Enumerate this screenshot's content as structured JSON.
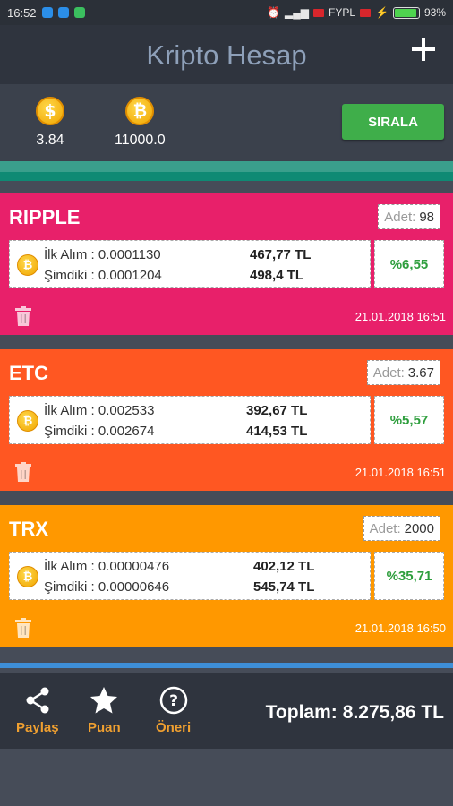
{
  "status_bar": {
    "time": "16:52",
    "carrier": "FYPL",
    "battery": "93%",
    "battery_level": 0.93
  },
  "header": {
    "title": "Kripto Hesap",
    "add_icon": "plus-icon"
  },
  "summary": {
    "stat1": {
      "icon": "dollar-coin-icon",
      "glyph": "$",
      "value": "3.84"
    },
    "stat2": {
      "icon": "bitcoin-coin-icon",
      "glyph": "₿",
      "value": "11000.0"
    },
    "sort_label": "SIRALA"
  },
  "colors": {
    "ripple": "#e8206a",
    "etc": "#ff5722",
    "trx": "#ff9800",
    "sort_button": "#3fae4a",
    "percent_text": "#2e9e3d",
    "bottom_label": "#f0a030"
  },
  "labels": {
    "qty": "Adet:",
    "first_buy": "İlk Alım :",
    "current": "Şimdiki :"
  },
  "cards": [
    {
      "name": "RIPPLE",
      "qty": "98",
      "first_price": "0.0001130",
      "current_price": "0.0001204",
      "first_tl": "467,77 TL",
      "current_tl": "498,4 TL",
      "percent": "%6,55",
      "date": "21.01.2018 16:51"
    },
    {
      "name": "ETC",
      "qty": "3.67",
      "first_price": "0.002533",
      "current_price": "0.002674",
      "first_tl": "392,67 TL",
      "current_tl": "414,53 TL",
      "percent": "%5,57",
      "date": "21.01.2018 16:51"
    },
    {
      "name": "TRX",
      "qty": "2000",
      "first_price": "0.00000476",
      "current_price": "0.00000646",
      "first_tl": "402,12 TL",
      "current_tl": "545,74 TL",
      "percent": "%35,71",
      "date": "21.01.2018 16:50"
    }
  ],
  "bottom": {
    "share_label": "Paylaş",
    "rate_label": "Puan",
    "suggest_label": "Öneri",
    "total_label": "Toplam:",
    "total_value": "8.275,86 TL"
  }
}
